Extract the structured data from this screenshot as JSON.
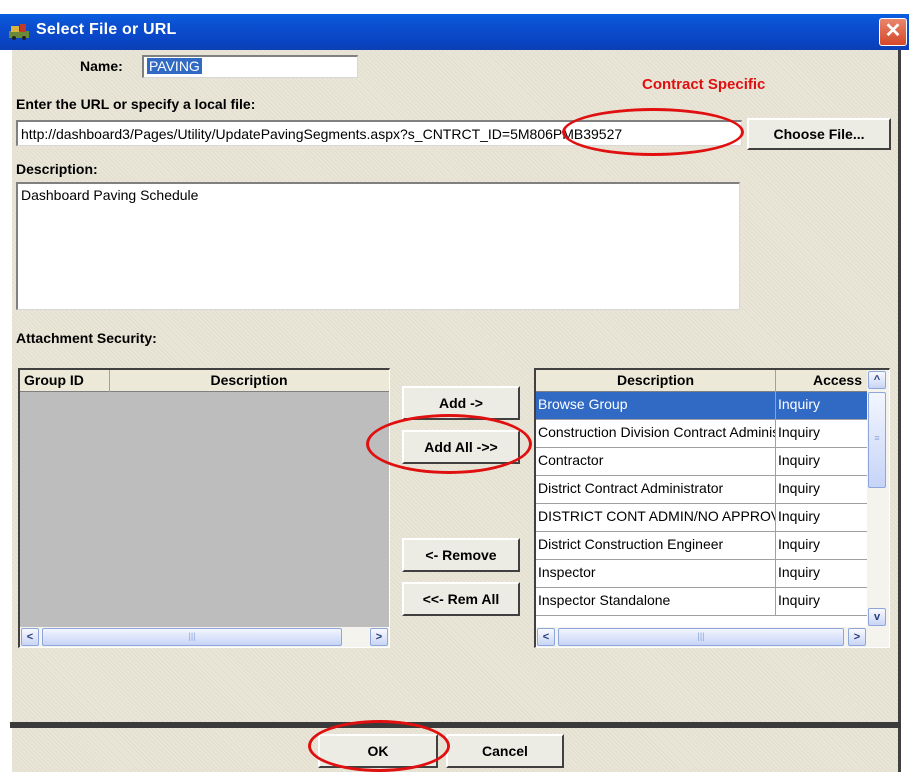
{
  "window": {
    "title": "Select File or URL",
    "close_glyph": "✕"
  },
  "name_field": {
    "label": "Name:",
    "value": "PAVING"
  },
  "annotation": {
    "text": "Contract Specific"
  },
  "url_field": {
    "label": "Enter the URL or specify a local file:",
    "value": "http://dashboard3/Pages/Utility/UpdatePavingSegments.aspx?s_CNTRCT_ID=5M806PMB39527"
  },
  "choose_file_button": {
    "label": "Choose File..."
  },
  "description_field": {
    "label": "Description:",
    "value": "Dashboard Paving Schedule"
  },
  "security": {
    "label": "Attachment Security:",
    "left_grid": {
      "columns": [
        "Group ID",
        "Description"
      ]
    },
    "right_grid": {
      "columns": [
        "Description",
        "Access"
      ],
      "rows": [
        {
          "description": "Browse Group",
          "access": "Inquiry",
          "selected": true
        },
        {
          "description": "Construction Division Contract Administrator",
          "access": "Inquiry"
        },
        {
          "description": "Contractor",
          "access": "Inquiry"
        },
        {
          "description": "District Contract Administrator",
          "access": "Inquiry"
        },
        {
          "description": "DISTRICT CONT ADMIN/NO APPROVAL",
          "access": "Inquiry"
        },
        {
          "description": "District Construction Engineer",
          "access": "Inquiry"
        },
        {
          "description": "Inspector",
          "access": "Inquiry"
        },
        {
          "description": "Inspector Standalone",
          "access": "Inquiry"
        }
      ]
    }
  },
  "buttons": {
    "add": "Add ->",
    "add_all": "Add All ->>",
    "remove": "<- Remove",
    "rem_all": "<<- Rem All",
    "ok": "OK",
    "cancel": "Cancel"
  },
  "colors": {
    "title_bar": "#0b4fd0",
    "annotation_red": "#e01010",
    "selection": "#316ac5"
  },
  "icons": [
    "app-icon",
    "close-icon",
    "scroll-left-icon",
    "scroll-right-icon",
    "scroll-up-icon",
    "scroll-down-icon"
  ]
}
